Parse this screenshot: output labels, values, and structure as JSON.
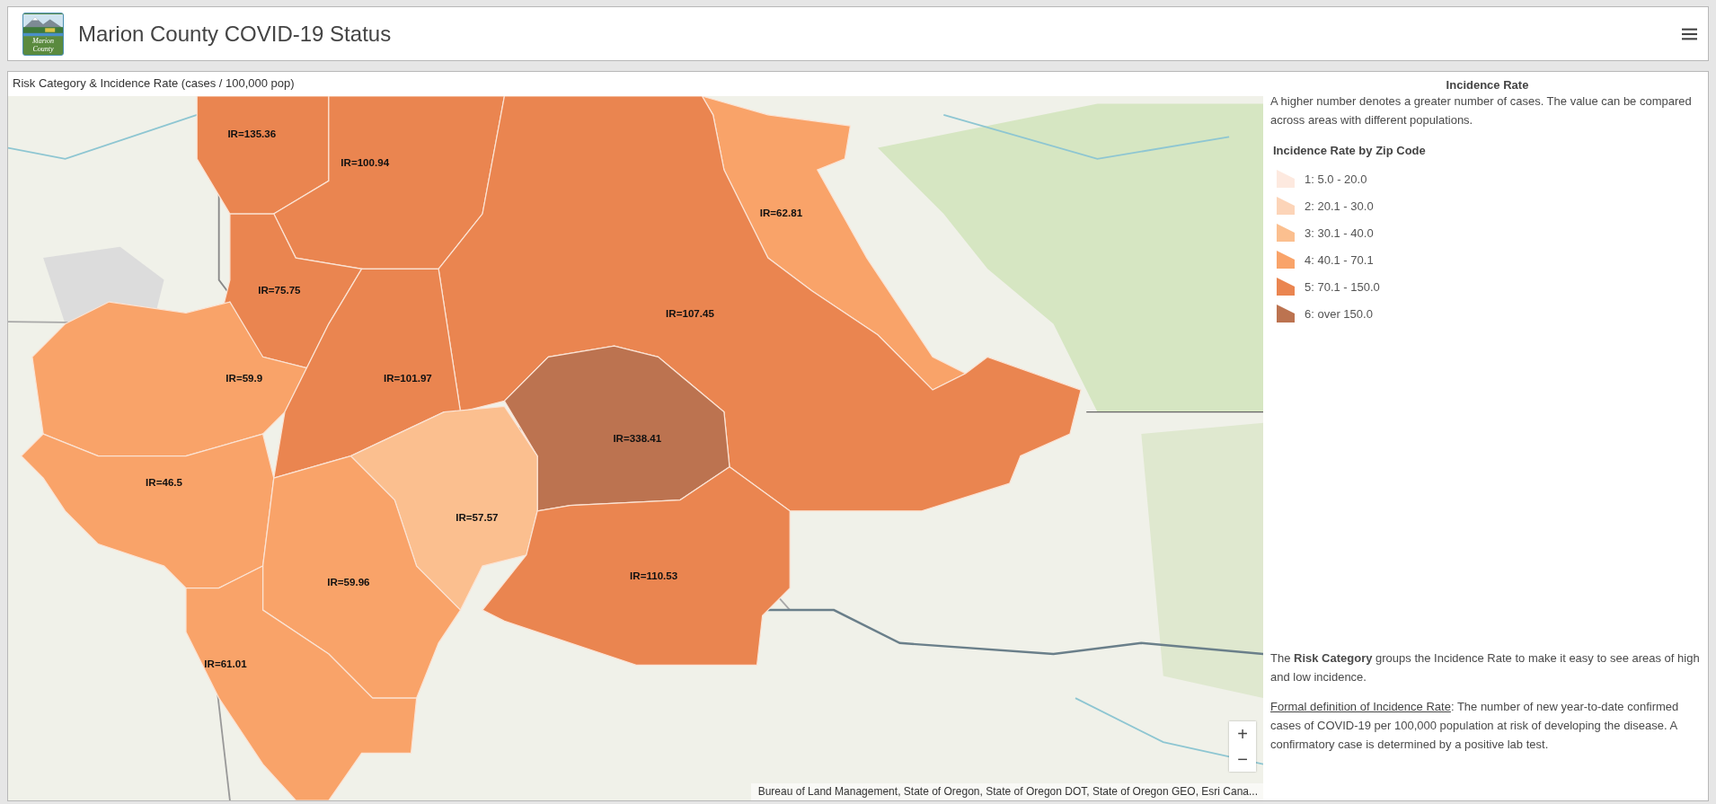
{
  "header": {
    "logo_text": "Marion County",
    "title": "Marion County COVID-19 Status"
  },
  "map_panel": {
    "title": "Risk Category & Incidence Rate (cases / 100,000 pop)",
    "zones": [
      {
        "label": "IR=135.36",
        "color": "#ea8550"
      },
      {
        "label": "IR=100.94",
        "color": "#ea8550"
      },
      {
        "label": "IR=62.81",
        "color": "#f9a369"
      },
      {
        "label": "IR=75.75",
        "color": "#ea8550"
      },
      {
        "label": "IR=107.45",
        "color": "#ea8550"
      },
      {
        "label": "IR=59.9",
        "color": "#f9a369"
      },
      {
        "label": "IR=101.97",
        "color": "#ea8550"
      },
      {
        "label": "IR=338.41",
        "color": "#bc7350"
      },
      {
        "label": "IR=46.5",
        "color": "#f9a369"
      },
      {
        "label": "IR=57.57",
        "color": "#fbbf8f"
      },
      {
        "label": "IR=110.53",
        "color": "#ea8550"
      },
      {
        "label": "IR=59.96",
        "color": "#f9a369"
      },
      {
        "label": "IR=61.01",
        "color": "#f9a369"
      }
    ],
    "zoom_in": "+",
    "zoom_out": "−",
    "attribution": "Bureau of Land Management, State of Oregon, State of Oregon DOT, State of Oregon GEO, Esri Cana..."
  },
  "sidebar": {
    "title": "Incidence Rate",
    "intro": "A higher number denotes a  greater number of cases. The value can be compared across areas with different populations.",
    "legend_title": "Incidence Rate by Zip Code",
    "legend": [
      {
        "label": "1: 5.0 - 20.0",
        "color": "#fde9df"
      },
      {
        "label": "2: 20.1 - 30.0",
        "color": "#fcd4b8"
      },
      {
        "label": "3: 30.1 - 40.0",
        "color": "#fbbf8f"
      },
      {
        "label": "4: 40.1 - 70.1",
        "color": "#f9a369"
      },
      {
        "label": "5: 70.1 - 150.0",
        "color": "#ea8550"
      },
      {
        "label": "6: over 150.0",
        "color": "#bc7350"
      }
    ],
    "risk_text": "The **Risk Category** groups the Incidence Rate to make it easy to see areas of high and low incidence.",
    "definition_link": "Formal definition of Incidence Rate",
    "definition_text": ": The number of new year-to-date confirmed cases of COVID-19 per 100,000 population at risk of developing the disease. A confirmatory case is determined by a positive lab test."
  }
}
